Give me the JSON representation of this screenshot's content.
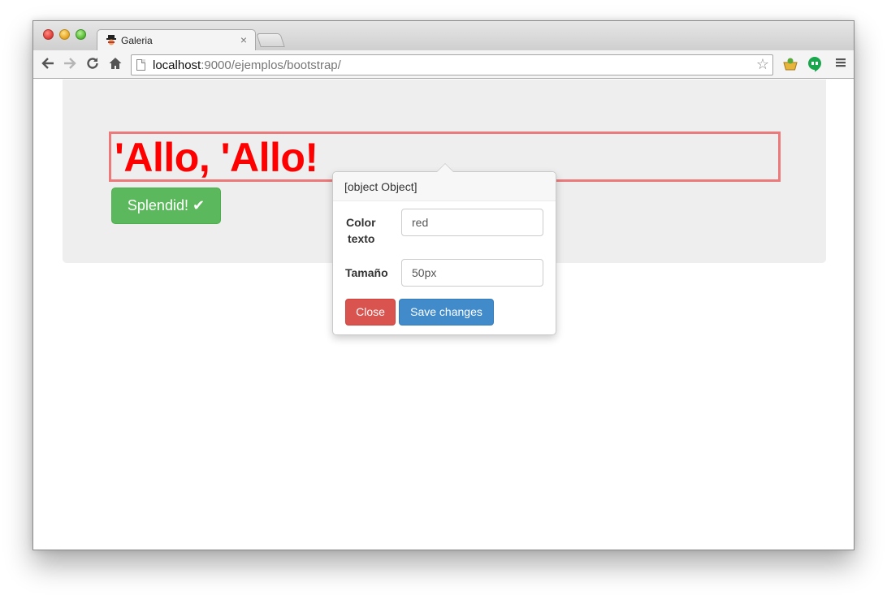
{
  "browser": {
    "tab_title": "Galeria",
    "tab_close": "×",
    "url_host": "localhost",
    "url_path": ":9000/ejemplos/bootstrap/",
    "icons": {
      "back": "arrow-left-icon",
      "forward": "arrow-right-icon",
      "reload": "reload-icon",
      "home": "home-icon",
      "star": "star-icon",
      "menu": "hamburger-menu-icon"
    }
  },
  "page": {
    "heading": "'Allo, 'Allo!",
    "splendid_label": "Splendid!",
    "splendid_icon": "✔"
  },
  "popover": {
    "title": "[object Object]",
    "color_label_line1": "Color",
    "color_label_line2": "texto",
    "color_value": "red",
    "size_label": "Tamaño",
    "size_value": "50px",
    "close_label": "Close",
    "save_label": "Save changes"
  },
  "colors": {
    "heading": "#ff0000",
    "success": "#5cb85c",
    "danger": "#d9534f",
    "primary": "#428bca"
  }
}
